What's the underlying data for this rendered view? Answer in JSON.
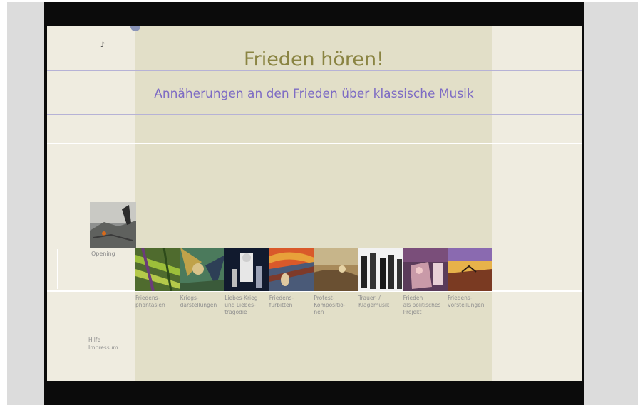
{
  "header": {
    "title": "Frieden hören!",
    "subtitle": "Annäherungen an den Frieden über klassische  Musik"
  },
  "opening": {
    "label": "Opening"
  },
  "categories": [
    {
      "label": "Friedens-\nphantasien"
    },
    {
      "label": "Kriegs-\ndarstellungen"
    },
    {
      "label": "Liebes-Krieg\nund Liebes-\ntragödie"
    },
    {
      "label": "Friedens-\nfürbitten"
    },
    {
      "label": "Protest-\nKompositio-\nnen"
    },
    {
      "label": "Trauer- /\nKlagemusik"
    },
    {
      "label": "Frieden\nals politisches\nProjekt"
    },
    {
      "label": "Friedens-\nvorstellungen"
    }
  ],
  "footer": {
    "help": "Hilfe",
    "imprint": "Impressum"
  },
  "colors": {
    "page_bg": "#efece0",
    "center_column": "#e2dfc8",
    "title": "#8a8442",
    "subtitle": "#7e6cc4",
    "staff_lines": "#b6b2d6"
  }
}
